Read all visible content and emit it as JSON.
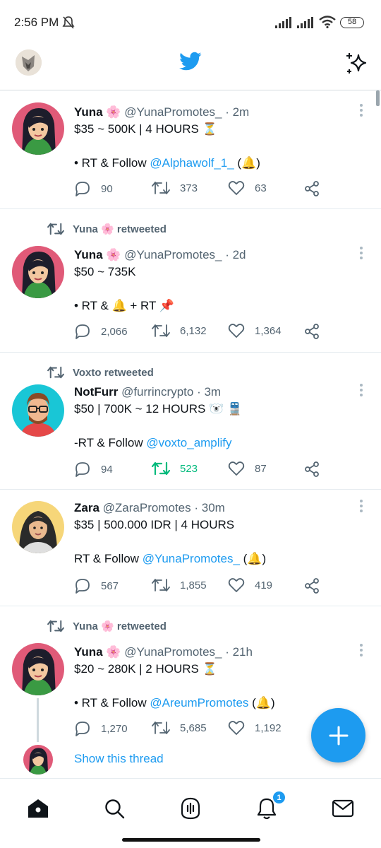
{
  "status": {
    "time": "2:56 PM",
    "battery": "58"
  },
  "colors": {
    "accent": "#1d9bf0",
    "retweeted": "#00ba7c",
    "muted": "#536471"
  },
  "tweets": [
    {
      "retweeted_by": "",
      "name": "Yuna 🌸",
      "handle": "@YunaPromotes_",
      "time": "· 2m",
      "line1": "$35 ~ 500K | 4 HOURS ⏳",
      "body_prefix": "• RT & Follow ",
      "mention": "@Alphawolf_1_",
      "body_suffix": " (🔔)",
      "replies": "90",
      "retweets": "373",
      "likes": "63"
    },
    {
      "retweeted_by": "Yuna 🌸 retweeted",
      "name": "Yuna 🌸",
      "handle": "@YunaPromotes_",
      "time": "· 2d",
      "line1": "$50 ~ 735K",
      "body_prefix": "• RT & 🔔 + RT 📌",
      "mention": "",
      "body_suffix": "",
      "replies": "2,066",
      "retweets": "6,132",
      "likes": "1,364"
    },
    {
      "retweeted_by": "Voxto retweeted",
      "name": "NotFurr",
      "handle": "@furrincrypto",
      "time": "· 3m",
      "line1": "$50 | 700K ~ 12 HOURS 🐻‍❄️ 🚆",
      "body_prefix": "-RT & Follow ",
      "mention": "@voxto_amplify",
      "body_suffix": "",
      "replies": "94",
      "retweets": "523",
      "likes": "87"
    },
    {
      "retweeted_by": "",
      "name": "Zara",
      "handle": "@ZaraPromotes",
      "time": "· 30m",
      "line1": "$35 | 500.000 IDR | 4 HOURS",
      "body_prefix": "RT & Follow ",
      "mention": "@YunaPromotes_",
      "body_suffix": " (🔔)",
      "replies": "567",
      "retweets": "1,855",
      "likes": "419"
    },
    {
      "retweeted_by": "Yuna 🌸 retweeted",
      "name": "Yuna 🌸",
      "handle": "@YunaPromotes_",
      "time": "· 21h",
      "line1": "$20 ~ 280K | 2 HOURS ⏳",
      "body_prefix": "• RT & Follow ",
      "mention": "@AreumPromotes",
      "body_suffix": " (🔔)",
      "replies": "1,270",
      "retweets": "5,685",
      "likes": "1,192"
    }
  ],
  "show_thread": "Show this thread",
  "nav": {
    "icons": [
      "home-icon",
      "search-icon",
      "spaces-icon",
      "notifications-icon",
      "messages-icon"
    ],
    "notification_badge": "1"
  }
}
